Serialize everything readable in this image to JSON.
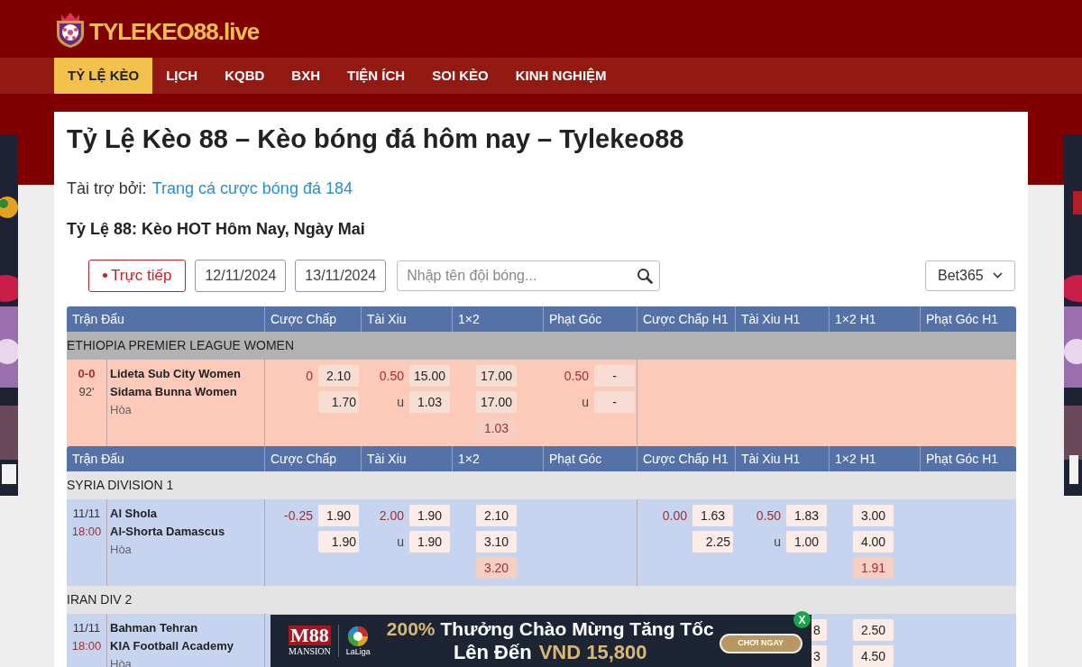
{
  "site": {
    "logo_text": "TYLEKEO88.live"
  },
  "nav": [
    {
      "label": "TỶ LỆ KÈO",
      "selected": true
    },
    {
      "label": "LỊCH",
      "selected": false
    },
    {
      "label": "KQBD",
      "selected": false
    },
    {
      "label": "BXH",
      "selected": false
    },
    {
      "label": "TIỆN ÍCH",
      "selected": false
    },
    {
      "label": "SOI KÈO",
      "selected": false
    },
    {
      "label": "KINH NGHIỆM",
      "selected": false
    }
  ],
  "page": {
    "title": "Tỷ Lệ Kèo 88 – Kèo bóng đá hôm nay – Tylekeo88",
    "sponsor_label": "Tài trợ bởi:",
    "sponsor_link": "Trang cá cược bóng đá 184",
    "subtitle": "Tỷ Lệ 88: Kèo HOT Hôm Nay, Ngày Mai"
  },
  "filters": {
    "live_button": "Trực tiếp",
    "dates": [
      "12/11/2024",
      "13/11/2024"
    ],
    "search_placeholder": "Nhập tên đội bóng...",
    "bookmaker": "Bet365"
  },
  "blocks": [
    {
      "kind": "header",
      "columns": [
        "Trận Đấu",
        "Cược Chấp",
        "Tài Xiu",
        "1×2",
        "Phạt Góc",
        "Cược Chấp H1",
        "Tài Xiu H1",
        "1×2 H1",
        "Phạt Góc H1"
      ]
    },
    {
      "kind": "league",
      "name": "ETHIOPIA PREMIER LEAGUE WOMEN",
      "live": true
    },
    {
      "kind": "match",
      "live": true,
      "top": "0-0",
      "bottom": "92'",
      "home": "Lideta Sub City Women",
      "away": "Sidama Bunna Women",
      "draw_label": "Hòa",
      "markets": {
        "handicap": [
          {
            "line": "0",
            "odd": "2.10"
          },
          {
            "odd": "1.70"
          }
        ],
        "over_under": [
          {
            "line": "0.50",
            "odd": "15.00"
          },
          {
            "side": "u",
            "odd": "1.03"
          }
        ],
        "one_x_two": [
          {
            "odd": "17.00"
          },
          {
            "odd": "17.00"
          },
          {
            "odd": "1.03",
            "draw": true
          }
        ],
        "corners": [
          {
            "line": "0.50",
            "odd": "-"
          },
          {
            "side": "u",
            "odd": "-"
          }
        ]
      }
    },
    {
      "kind": "header",
      "columns": [
        "Trận Đấu",
        "Cược Chấp",
        "Tài Xiu",
        "1×2",
        "Phạt Góc",
        "Cược Chấp H1",
        "Tài Xiu H1",
        "1×2 H1",
        "Phạt Góc H1"
      ]
    },
    {
      "kind": "league",
      "name": "SYRIA DIVISION 1",
      "live": false
    },
    {
      "kind": "match",
      "live": false,
      "top": "11/11",
      "bottom": "18:00",
      "home": "Al Shola",
      "away": "Al-Shorta Damascus",
      "draw_label": "Hòa",
      "markets": {
        "handicap": [
          {
            "line": "-0.25",
            "odd": "1.90"
          },
          {
            "odd": "1.90"
          }
        ],
        "over_under": [
          {
            "line": "2.00",
            "odd": "1.90"
          },
          {
            "side": "u",
            "odd": "1.90"
          }
        ],
        "one_x_two": [
          {
            "odd": "2.10"
          },
          {
            "odd": "3.10"
          },
          {
            "odd": "3.20",
            "draw": true
          }
        ],
        "handicap_h1": [
          {
            "line": "0.00",
            "odd": "1.63"
          },
          {
            "odd": "2.25"
          }
        ],
        "over_under_h1": [
          {
            "line": "0.50",
            "odd": "1.83"
          },
          {
            "side": "u",
            "odd": "1.00"
          }
        ],
        "one_x_two_h1": [
          {
            "odd": "3.00"
          },
          {
            "odd": "4.00"
          },
          {
            "odd": "1.91",
            "draw": true
          }
        ]
      }
    },
    {
      "kind": "league",
      "name": "IRAN DIV 2",
      "live": false
    },
    {
      "kind": "match",
      "live": false,
      "top": "11/11",
      "bottom": "18:00",
      "home": "Bahman Tehran",
      "away": "KIA Football Academy",
      "draw_label": "Hòa",
      "markets": {
        "over_under_h1": [
          {
            "odd": "8",
            "kind": "partial"
          },
          {
            "odd": "3",
            "kind": "partial"
          }
        ],
        "one_x_two_h1": [
          {
            "odd": "2.50"
          },
          {
            "odd": "4.50"
          }
        ]
      }
    }
  ],
  "banner": {
    "brand": "M88",
    "brand_sub": "MANSION",
    "league": "LaLiga",
    "headline_accent": "200%",
    "headline": "Thưởng Chào Mừng Tăng Tốc",
    "line2": "Lên Đến",
    "line2_accent": "VND 15,800",
    "cta": "CHƠI NGAY",
    "close": "X"
  }
}
